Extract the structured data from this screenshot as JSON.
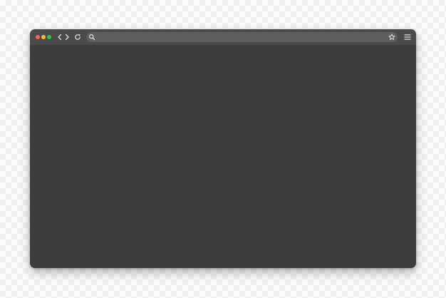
{
  "colors": {
    "window_content": "#3d3d3d",
    "toolbar": "#4a4a4a",
    "address_bar": "#5e5e5e",
    "icon": "#e0e0e0",
    "close_dot": "#ff5f57",
    "minimize_dot": "#febc2e",
    "maximize_dot": "#28c840"
  },
  "toolbar": {
    "window_controls": [
      {
        "name": "close",
        "color": "#ff5f57"
      },
      {
        "name": "minimize",
        "color": "#febc2e"
      },
      {
        "name": "maximize",
        "color": "#28c840"
      }
    ],
    "nav_icons": [
      "chevron-left-icon",
      "chevron-right-icon",
      "reload-icon"
    ],
    "address_bar": {
      "value": "",
      "placeholder": "",
      "left_icon": "search-icon",
      "right_icon": "star-icon"
    },
    "menu_icon": "hamburger-menu-icon"
  }
}
